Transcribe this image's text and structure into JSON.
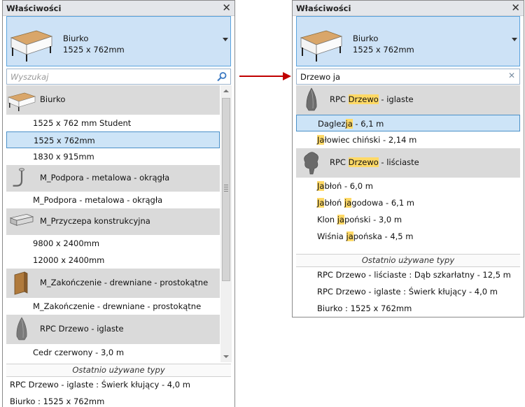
{
  "left": {
    "title": "Właściwości",
    "selector": {
      "name": "Biurko",
      "size": "1525 x 762mm"
    },
    "search": {
      "placeholder": "Wyszukaj",
      "value": ""
    },
    "list": {
      "g1": "Biurko",
      "g1_items": [
        "1525 x 762 mm Student",
        "1525 x 762mm",
        "1830 x 915mm"
      ],
      "g2": "M_Podpora - metalowa - okrągła",
      "g2_items": [
        "M_Podpora - metalowa - okrągła"
      ],
      "g3": "M_Przyczepa konstrukcyjna",
      "g3_items": [
        "9800 x 2400mm",
        "12000 x 2400mm"
      ],
      "g4": "M_Zakończenie - drewniane - prostokątne",
      "g4_items": [
        "M_Zakończenie - drewniane - prostokątne"
      ],
      "g5": "RPC Drzewo - iglaste",
      "g5_items": [
        "Cedr czerwony - 3,0 m"
      ]
    },
    "recent_header": "Ostatnio używane typy",
    "recent": [
      "RPC Drzewo - iglaste : Świerk kłujący - 4,0 m",
      "Biurko : 1525 x 762mm"
    ]
  },
  "right": {
    "title": "Właściwości",
    "selector": {
      "name": "Biurko",
      "size": "1525 x 762mm"
    },
    "search": {
      "value": "Drzewo ja"
    },
    "list": {
      "g1": {
        "pre": "RPC ",
        "hl": "Drzewo",
        "post": " - iglaste"
      },
      "g1_items": [
        {
          "pre": "Daglez",
          "hl": "ja",
          "post": " - 6,1 m"
        },
        {
          "pre": "",
          "hl": "Ja",
          "post": "łowiec chiński - 2,14 m"
        }
      ],
      "g2": {
        "pre": "RPC ",
        "hl": "Drzewo",
        "post": " - liściaste"
      },
      "g2_items": [
        {
          "pre": "",
          "hl": "Ja",
          "post": "błoń - 6,0 m"
        },
        {
          "pre": "",
          "hl": "Ja",
          "mid": "błoń ",
          "hl2": "ja",
          "post": "godowa - 6,1 m"
        },
        {
          "pre": "Klon ",
          "hl": "ja",
          "post": "poński - 3,0 m"
        },
        {
          "pre": "Wiśnia ",
          "hl": "ja",
          "post": "pońska - 4,5 m"
        }
      ]
    },
    "recent_header": "Ostatnio używane typy",
    "recent": [
      "RPC Drzewo - liściaste : Dąb szkarłatny - 12,5 m",
      "RPC Drzewo - iglaste : Świerk kłujący - 4,0 m",
      "Biurko : 1525 x 762mm"
    ]
  },
  "colors": {
    "highlight": "#ffd966",
    "selection": "#cde4f7",
    "arrow": "#c00000"
  }
}
